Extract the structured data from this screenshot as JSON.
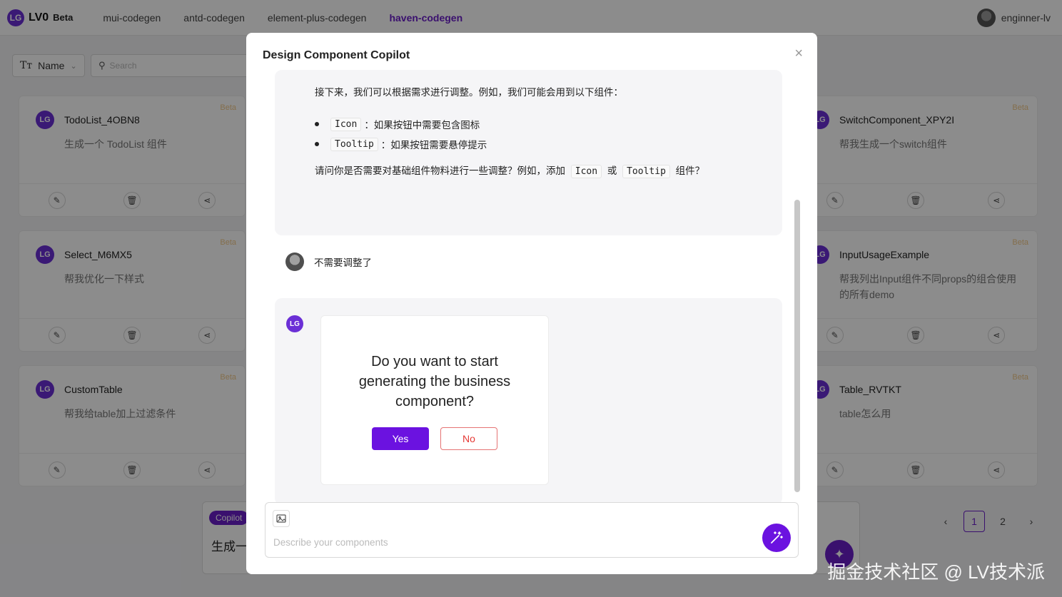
{
  "header": {
    "logo_mark": "LG",
    "app_name": "LV0",
    "beta_label": "Beta",
    "tabs": [
      {
        "label": "mui-codegen",
        "active": false
      },
      {
        "label": "antd-codegen",
        "active": false
      },
      {
        "label": "element-plus-codegen",
        "active": false
      },
      {
        "label": "haven-codegen",
        "active": true
      }
    ],
    "user_name": "enginner-lv"
  },
  "filter": {
    "sort_icon": "Tт",
    "sort_label": "Name",
    "search_placeholder": "Search"
  },
  "cards": [
    {
      "title": "TodoList_4OBN8",
      "desc": "生成一个 TodoList 组件",
      "badge": "Beta"
    },
    {
      "title": "SwitchComponent_XPY2I",
      "desc": "帮我生成一个switch组件",
      "badge": "Beta"
    },
    {
      "title": "Select_M6MX5",
      "desc": "帮我优化一下样式",
      "badge": "Beta"
    },
    {
      "title": "InputUsageExample",
      "desc": "帮我列出Input组件不同props的组合使用的所有demo",
      "badge": "Beta"
    },
    {
      "title": "CustomTable",
      "desc": "帮我给table加上过滤条件",
      "badge": "Beta"
    },
    {
      "title": "Table_RVTKT",
      "desc": "table怎么用",
      "badge": "Beta"
    }
  ],
  "background_copilot": {
    "tag": "Copilot",
    "text": "生成一"
  },
  "pagination": {
    "prev": "‹",
    "pages": [
      "1",
      "2"
    ],
    "current": "1",
    "next": "›"
  },
  "modal": {
    "title": "Design Component Copilot",
    "close": "×",
    "ai_message_1": {
      "intro": "接下来，我们可以根据需求进行调整。例如，我们可能会用到以下组件：",
      "items": [
        {
          "code": "Icon",
          "text": "：如果按钮中需要包含图标"
        },
        {
          "code": "Tooltip",
          "text": "：如果按钮需要悬停提示"
        }
      ],
      "question_prefix": "请问你是否需要对基础组件物料进行一些调整？例如，添加",
      "question_code_1": "Icon",
      "question_mid": "或",
      "question_code_2": "Tooltip",
      "question_suffix": "组件？"
    },
    "user_message": "不需要调整了",
    "ai_message_2": {
      "question": "Do you want to start generating the business component?",
      "yes_label": "Yes",
      "no_label": "No"
    },
    "input_placeholder": "Describe your components"
  },
  "watermark": "掘金技术社区 @ LV技术派",
  "colors": {
    "accent": "#6b12e0",
    "active_tab": "#6b1ec9",
    "no_button": "#e53935"
  }
}
